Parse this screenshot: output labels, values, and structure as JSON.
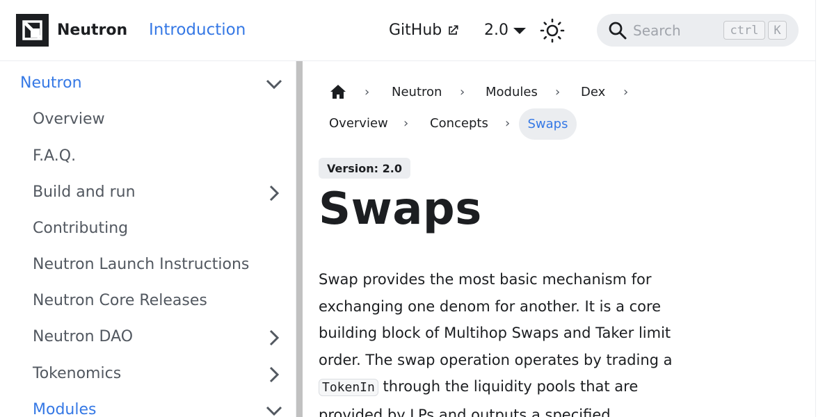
{
  "navbar": {
    "brand": "Neutron",
    "intro": "Introduction",
    "github": "GitHub",
    "version": "2.0",
    "search_placeholder": "Search",
    "kbd_ctrl": "ctrl",
    "kbd_k": "K"
  },
  "sidebar": {
    "items": [
      {
        "label": "Neutron",
        "active": true,
        "chevron": "down"
      },
      {
        "label": "Overview"
      },
      {
        "label": "F.A.Q."
      },
      {
        "label": "Build and run",
        "chevron": "right"
      },
      {
        "label": "Contributing"
      },
      {
        "label": "Neutron Launch Instructions"
      },
      {
        "label": "Neutron Core Releases"
      },
      {
        "label": "Neutron DAO",
        "chevron": "right"
      },
      {
        "label": "Tokenomics",
        "chevron": "right"
      },
      {
        "label": "Modules",
        "active": true,
        "chevron": "down"
      }
    ]
  },
  "breadcrumb": {
    "items": [
      "Neutron",
      "Modules",
      "Dex",
      "Overview",
      "Concepts"
    ],
    "current": "Swaps"
  },
  "doc": {
    "version_badge": "Version: 2.0",
    "title": "Swaps",
    "para_part1": "Swap provides the most basic mechanism for exchanging one denom for another. It is a core building block of Multihop Swaps and Taker limit order. The swap operation operates by trading a ",
    "para_code": "TokenIn",
    "para_part2": " through the liquidity pools that are provided by LPs and outputs a specified"
  },
  "colors": {
    "accent": "#3578e5",
    "text": "#1c1e21",
    "muted": "#525860"
  }
}
